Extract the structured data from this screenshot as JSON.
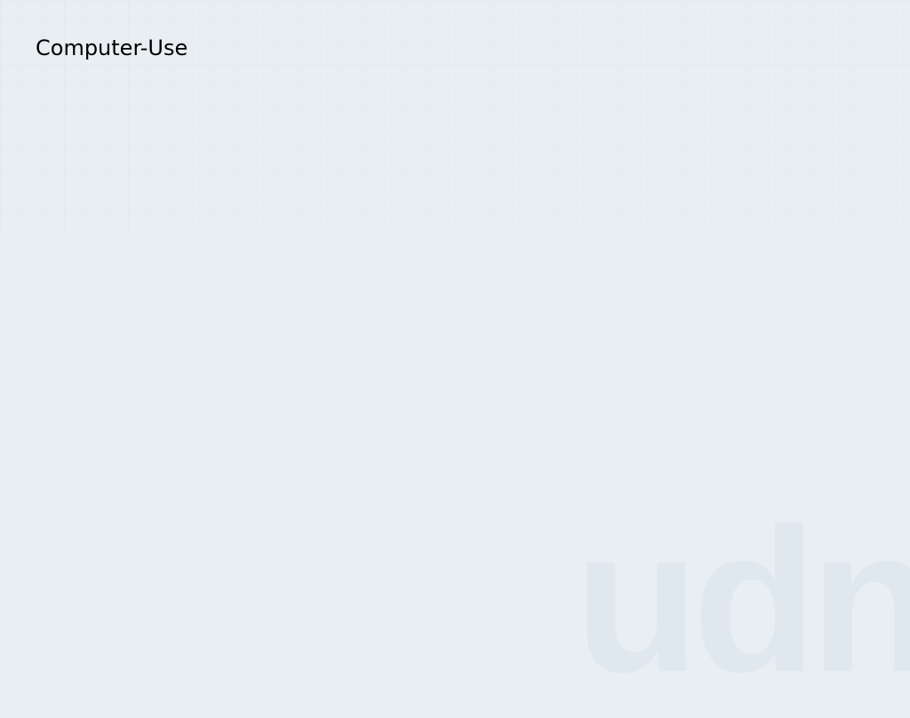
{
  "text": "Computer-Use"
}
